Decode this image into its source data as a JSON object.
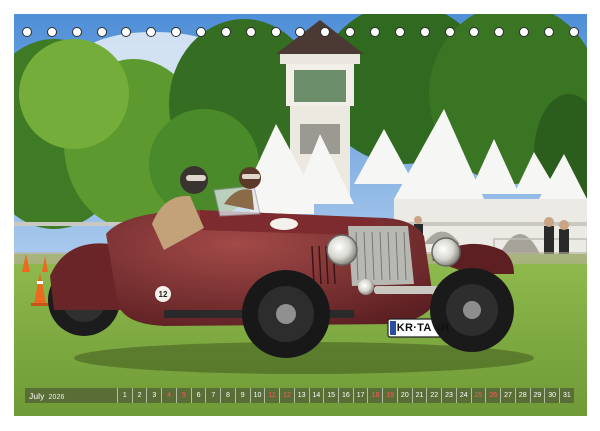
{
  "calendar": {
    "month": "July",
    "year": "2026",
    "days": [
      "1",
      "2",
      "3",
      "4",
      "5",
      "6",
      "7",
      "8",
      "9",
      "10",
      "11",
      "12",
      "13",
      "14",
      "15",
      "16",
      "17",
      "18",
      "19",
      "20",
      "21",
      "22",
      "23",
      "24",
      "25",
      "26",
      "27",
      "28",
      "29",
      "30",
      "31"
    ],
    "weekend_color": "#ff5a5a"
  },
  "photo": {
    "plate": "KR·TA 4H",
    "car_number": "12"
  },
  "binding": {
    "ring_count": 23
  }
}
